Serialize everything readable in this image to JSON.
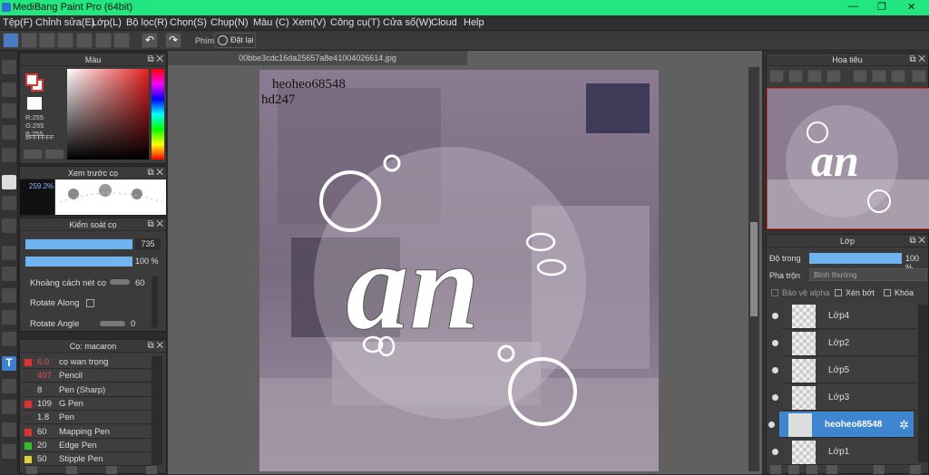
{
  "window": {
    "title": "MediBang Paint Pro (64bit)",
    "controls": [
      "—",
      "❐",
      "✕"
    ]
  },
  "menu": [
    "Tệp(F)",
    "Chỉnh sửa(E)",
    "Lớp(L)",
    "Bộ lọc(R)",
    "Chọn(S)",
    "Chụp(N)",
    "Màu (C)",
    "Xem(V)",
    "Công cụ(T)",
    "Cửa sổ(W)",
    "Cloud",
    "Help"
  ],
  "toolbar": {
    "snap_label": "Phím",
    "reset_label": "Đặt lại"
  },
  "color_panel": {
    "title": "Màu",
    "r": "R:255",
    "g": "G:255",
    "b": "B:255",
    "hex": "#FFFFFF",
    "fg": "#ffffff",
    "bg": "#ffffff"
  },
  "brush_preview": {
    "title": "Xem trước cọ",
    "size": "259.2%"
  },
  "brush_control": {
    "title": "Kiểm soát cọ",
    "size_value": "735",
    "opacity_value": "100 %",
    "spacing_label": "Khoảng cách nét cọ",
    "spacing_value": "60",
    "rotate_along_label": "Rotate Along",
    "rotate_angle_label": "Rotate Angle",
    "rotate_angle_value": "0"
  },
  "brush_list": {
    "title": "Cọ: macaron",
    "items": [
      {
        "size": "6.0",
        "name": "cọ wan trọng",
        "color": "#e03030",
        "size_color": "#e05050"
      },
      {
        "size": "407",
        "name": "Pencil",
        "color": "#3a3a3a",
        "size_color": "#e05050"
      },
      {
        "size": "8",
        "name": "Pen (Sharp)",
        "color": "#3a3a3a",
        "size_color": "#dddddd"
      },
      {
        "size": "109",
        "name": "G Pen",
        "color": "#e03030",
        "size_color": "#dddddd"
      },
      {
        "size": "1.8",
        "name": "Pen",
        "color": "#3a3a3a",
        "size_color": "#dddddd"
      },
      {
        "size": "60",
        "name": "Mapping Pen",
        "color": "#e03030",
        "size_color": "#dddddd"
      },
      {
        "size": "20",
        "name": "Edge Pen",
        "color": "#30c030",
        "size_color": "#dddddd"
      },
      {
        "size": "50",
        "name": "Stipple Pen",
        "color": "#e0d030",
        "size_color": "#dddddd"
      }
    ]
  },
  "document": {
    "tab_name": "00bbe3cdc16da25657a8e41004026614.jpg"
  },
  "canvas": {
    "watermark_line1": "heoheo68548",
    "watermark_line2": "hd247",
    "main_text": "an"
  },
  "navigator": {
    "title": "Hoa tiêu",
    "main_text": "an"
  },
  "layer_panel": {
    "title": "Lớp",
    "opacity_label": "Độ trong",
    "opacity_value": "100 %",
    "blend_label": "Pha trộn",
    "blend_value": "Bình thường",
    "protect_alpha": "Bảo vệ alpha",
    "clipping": "Xén bớt",
    "lock": "Khóa",
    "layers": [
      {
        "name": "Lớp4"
      },
      {
        "name": "Lớp2"
      },
      {
        "name": "Lớp5"
      },
      {
        "name": "Lớp3"
      },
      {
        "name": "heoheo68548"
      },
      {
        "name": "Lớp1"
      }
    ]
  }
}
